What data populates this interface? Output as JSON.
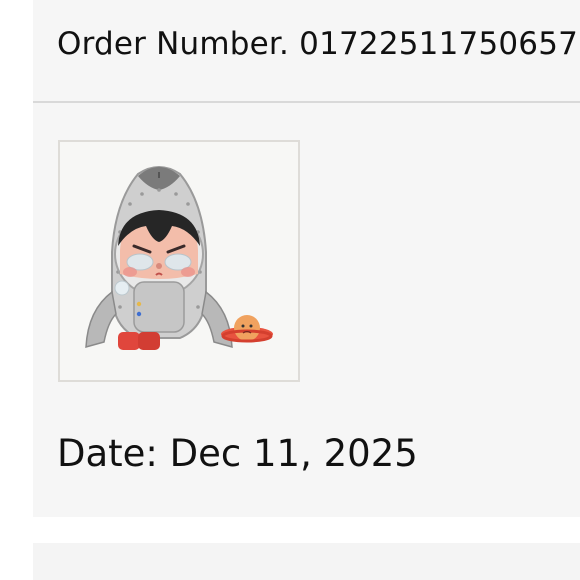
{
  "order": {
    "number_text": "Order Number. 01722511750657",
    "date_text": "Date: Dec 11, 2025",
    "product_image": {
      "icon": "rocket-figure-product-image",
      "description_colors": {
        "rocket_body": "#c9c9c9",
        "rocket_nose": "#7d7d7d",
        "face": "#f2b6a6",
        "hair": "#2a2a2a",
        "boots": "#e0463c",
        "planet": "#e8533f"
      }
    }
  }
}
